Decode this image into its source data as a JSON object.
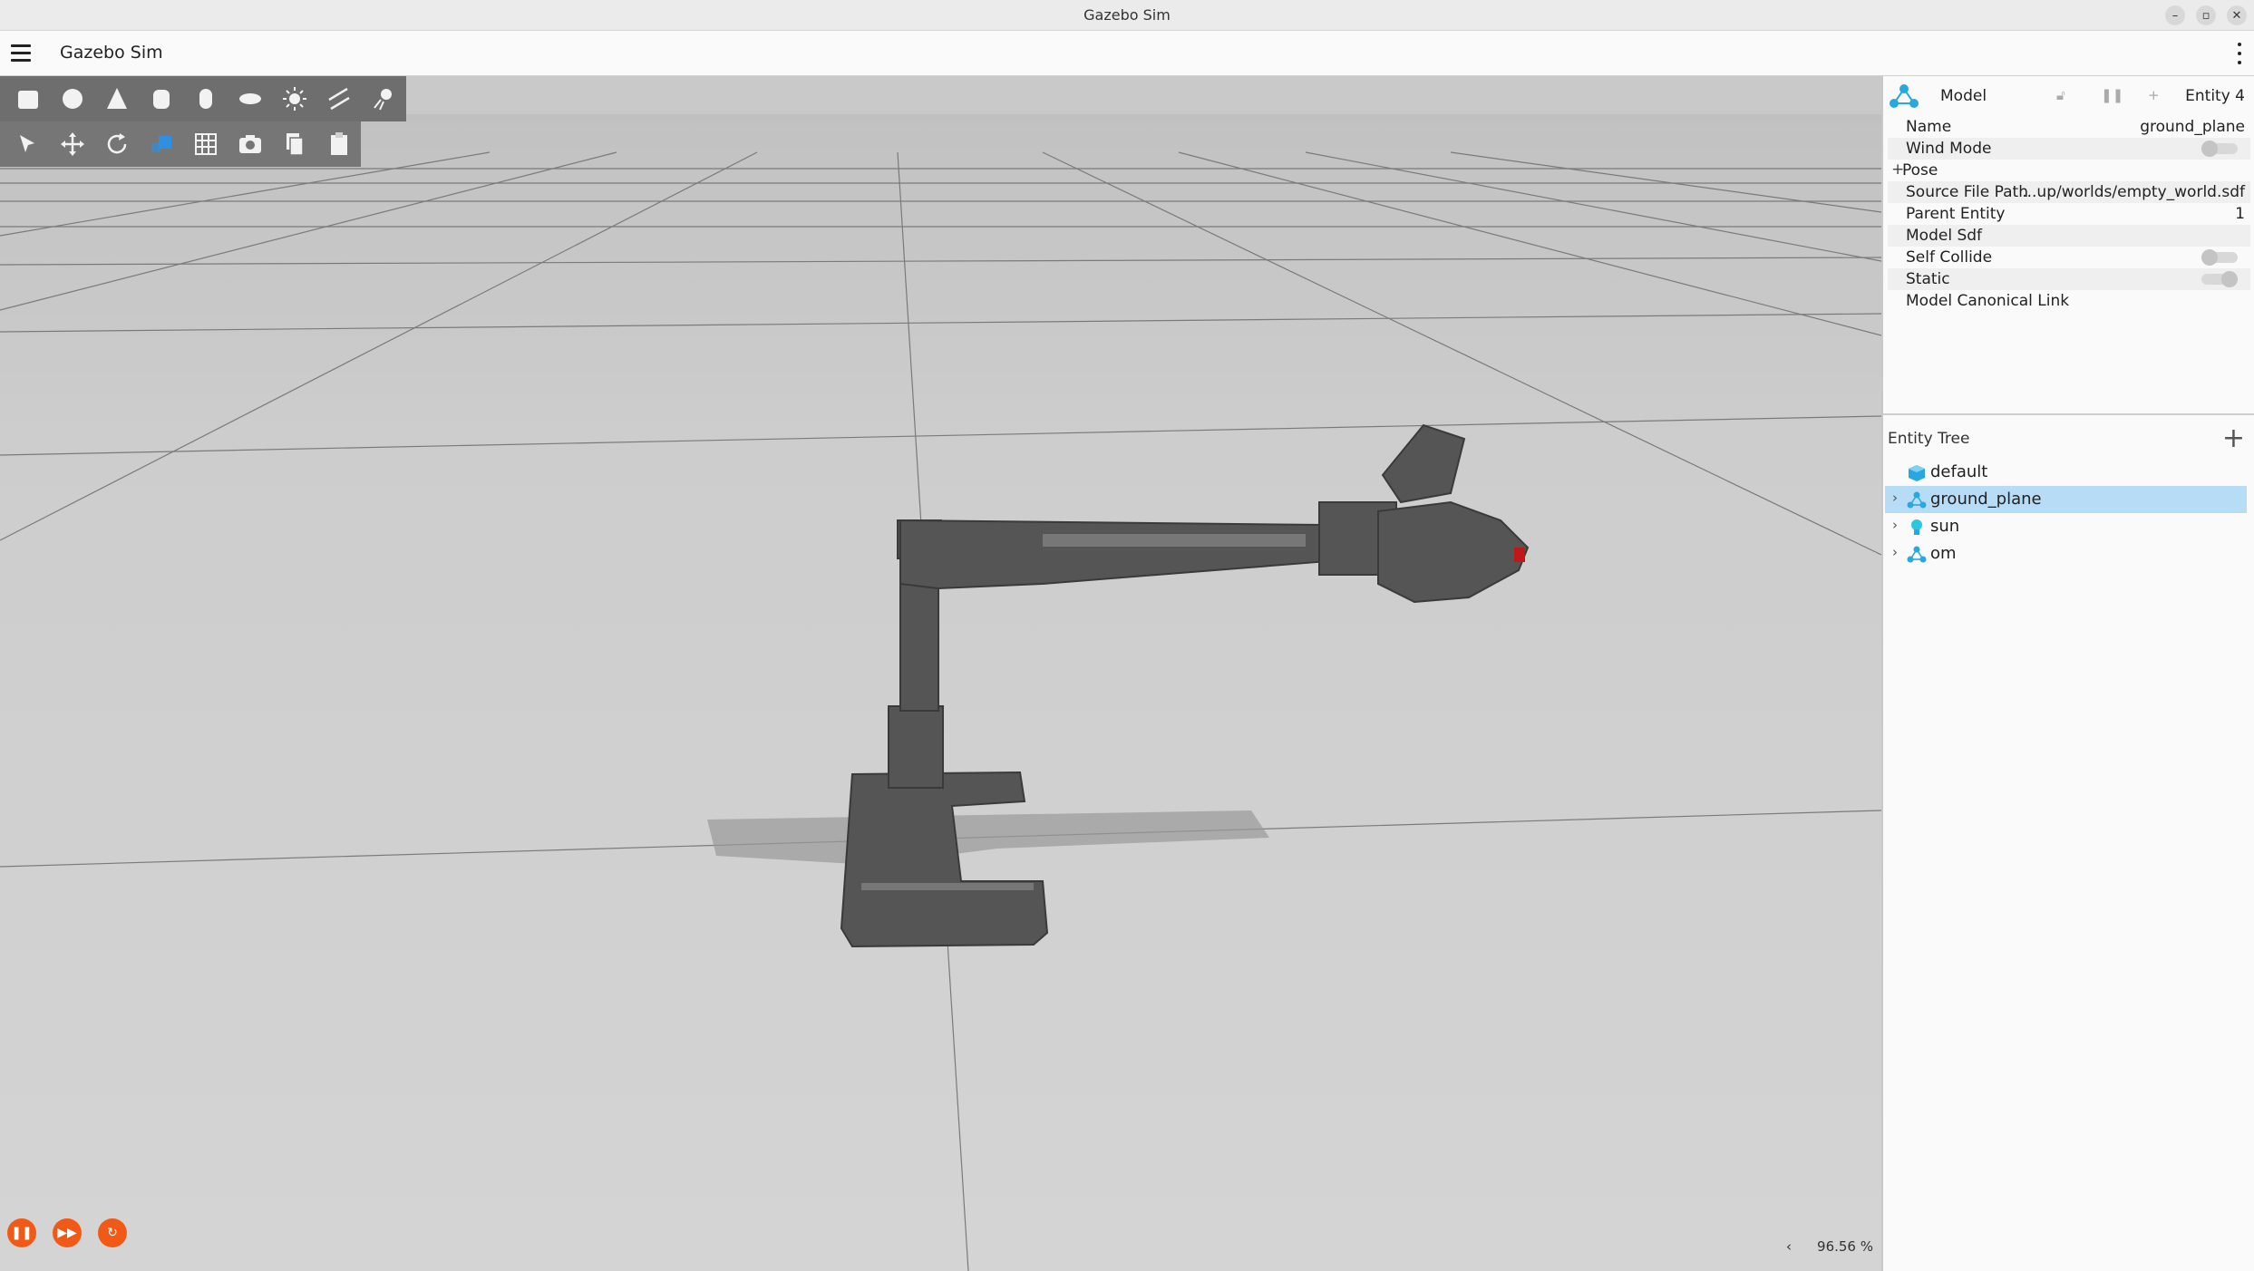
{
  "window": {
    "title": "Gazebo Sim"
  },
  "app": {
    "title": "Gazebo Sim"
  },
  "toolbar_shapes": [
    "box-icon",
    "sphere-icon",
    "cone-icon",
    "cylinder-icon",
    "capsule-icon",
    "ellipsoid-icon",
    "sun-light-icon",
    "directional-light-icon",
    "spot-light-icon"
  ],
  "toolbar_transform": [
    "select-icon",
    "translate-icon",
    "rotate-icon",
    "view-angle-icon",
    "grid-icon",
    "screenshot-icon",
    "copy-icon",
    "paste-icon"
  ],
  "component_inspector": {
    "type_label": "Model",
    "entity_label": "Entity 4",
    "rows": [
      {
        "key": "Name",
        "value": "ground_plane"
      },
      {
        "key": "Wind Mode",
        "toggle": false
      },
      {
        "key": "Pose",
        "expandable": true
      },
      {
        "key": "Source File Path",
        "value": "...up/worlds/empty_world.sdf"
      },
      {
        "key": "Parent Entity",
        "value": "1"
      },
      {
        "key": "Model Sdf"
      },
      {
        "key": "Self Collide",
        "toggle": false
      },
      {
        "key": "Static",
        "toggle": true
      },
      {
        "key": "Model Canonical Link"
      }
    ]
  },
  "entity_tree": {
    "title": "Entity Tree",
    "items": [
      {
        "name": "default",
        "icon": "world-cube-icon",
        "expandable": false,
        "selected": false
      },
      {
        "name": "ground_plane",
        "icon": "model-icon",
        "expandable": true,
        "selected": true
      },
      {
        "name": "sun",
        "icon": "light-bulb-icon",
        "expandable": true,
        "selected": false
      },
      {
        "name": "om",
        "icon": "model-icon",
        "expandable": true,
        "selected": false
      }
    ]
  },
  "playback": {
    "pause_icon": "pause-icon",
    "step_icon": "step-icon",
    "reset_icon": "reset-icon"
  },
  "status": {
    "collapse_glyph": "‹",
    "rtf": "96.56 %"
  },
  "colors": {
    "accent": "#f05a16",
    "selection": "#b7dcf6",
    "model_icon": "#29a8e0"
  }
}
